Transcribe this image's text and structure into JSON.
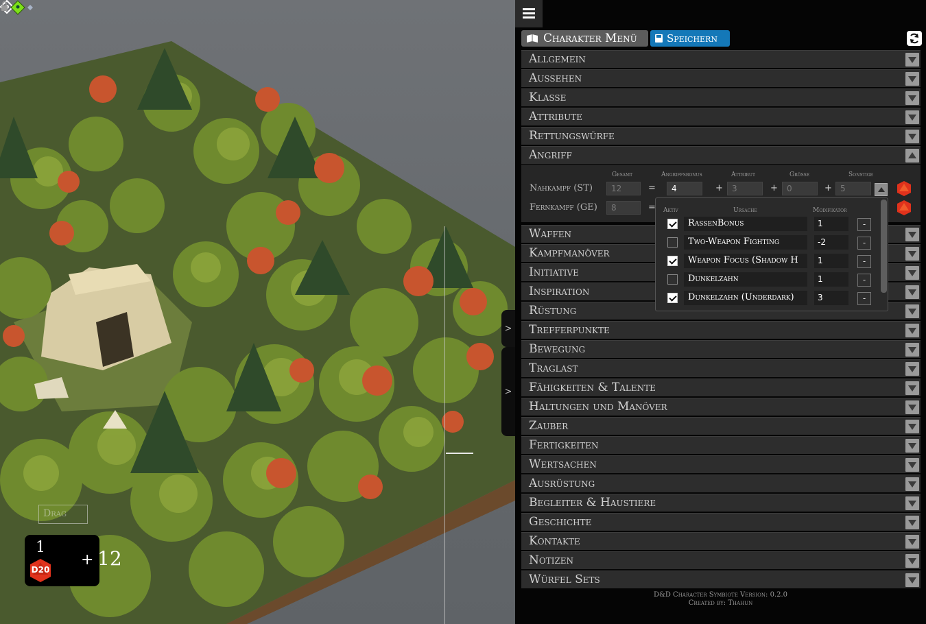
{
  "scene": {
    "drag_label": "Drag",
    "side_handle_1": ">",
    "side_handle_2": ">"
  },
  "dice": {
    "roll": "1",
    "die": "D20",
    "plus": "+",
    "modifier": "12"
  },
  "toolbar": {
    "menu_label": "Charakter Menü",
    "save_label": "Speichern"
  },
  "sections_top": [
    "Allgemein",
    "Aussehen",
    "Klasse",
    "Attribute",
    "Rettungswürfe",
    "Angriff"
  ],
  "attack": {
    "headers": {
      "total": "Gesamt",
      "attack_bonus": "Angriffsbonus",
      "attribute": "Attribut",
      "size": "Grösse",
      "other": "Sonstige"
    },
    "melee": {
      "label": "Nahkampf (ST)",
      "total": "12",
      "bonus": "4",
      "attribute": "3",
      "size": "0",
      "other": "5"
    },
    "ranged": {
      "label": "Fernkampf (GE)",
      "total": "8"
    },
    "eq": "=",
    "plus": "+"
  },
  "modifier_popup": {
    "headers": {
      "active": "Aktiv",
      "cause": "Ursache",
      "modifier": "Modifikator"
    },
    "rows": [
      {
        "active": true,
        "cause": "RassenBonus",
        "modifier": "1",
        "del": "-"
      },
      {
        "active": false,
        "cause": "Two-Weapon Fighting",
        "modifier": "-2",
        "del": "-"
      },
      {
        "active": true,
        "cause": "Weapon Focus (Shadow H",
        "modifier": "1",
        "del": "-"
      },
      {
        "active": false,
        "cause": "Dunkelzahn",
        "modifier": "1",
        "del": "-"
      },
      {
        "active": true,
        "cause": "Dunkelzahn (Underdark)",
        "modifier": "3",
        "del": "-"
      }
    ]
  },
  "sections_bottom": [
    "Waffen",
    "Kampfmanöver",
    "Initiative",
    "Inspiration",
    "Rüstung",
    "Trefferpunkte",
    "Bewegung",
    "Traglast",
    "Fähigkeiten & Talente",
    "Haltungen und Manöver",
    "Zauber",
    "Fertigkeiten",
    "Wertsachen",
    "Ausrüstung",
    "Begleiter & Haustiere",
    "Geschichte",
    "Kontakte",
    "Notizen",
    "Würfel Sets"
  ],
  "footer": {
    "line1": "D&D Character Symbiote  Version: 0.2.0",
    "line2": "Created by: Thahun"
  },
  "colors": {
    "panel_bg": "#050505",
    "section_bg": "#2d2d2d",
    "save_blue": "#1478b8",
    "dice_red": "#e0321c"
  }
}
